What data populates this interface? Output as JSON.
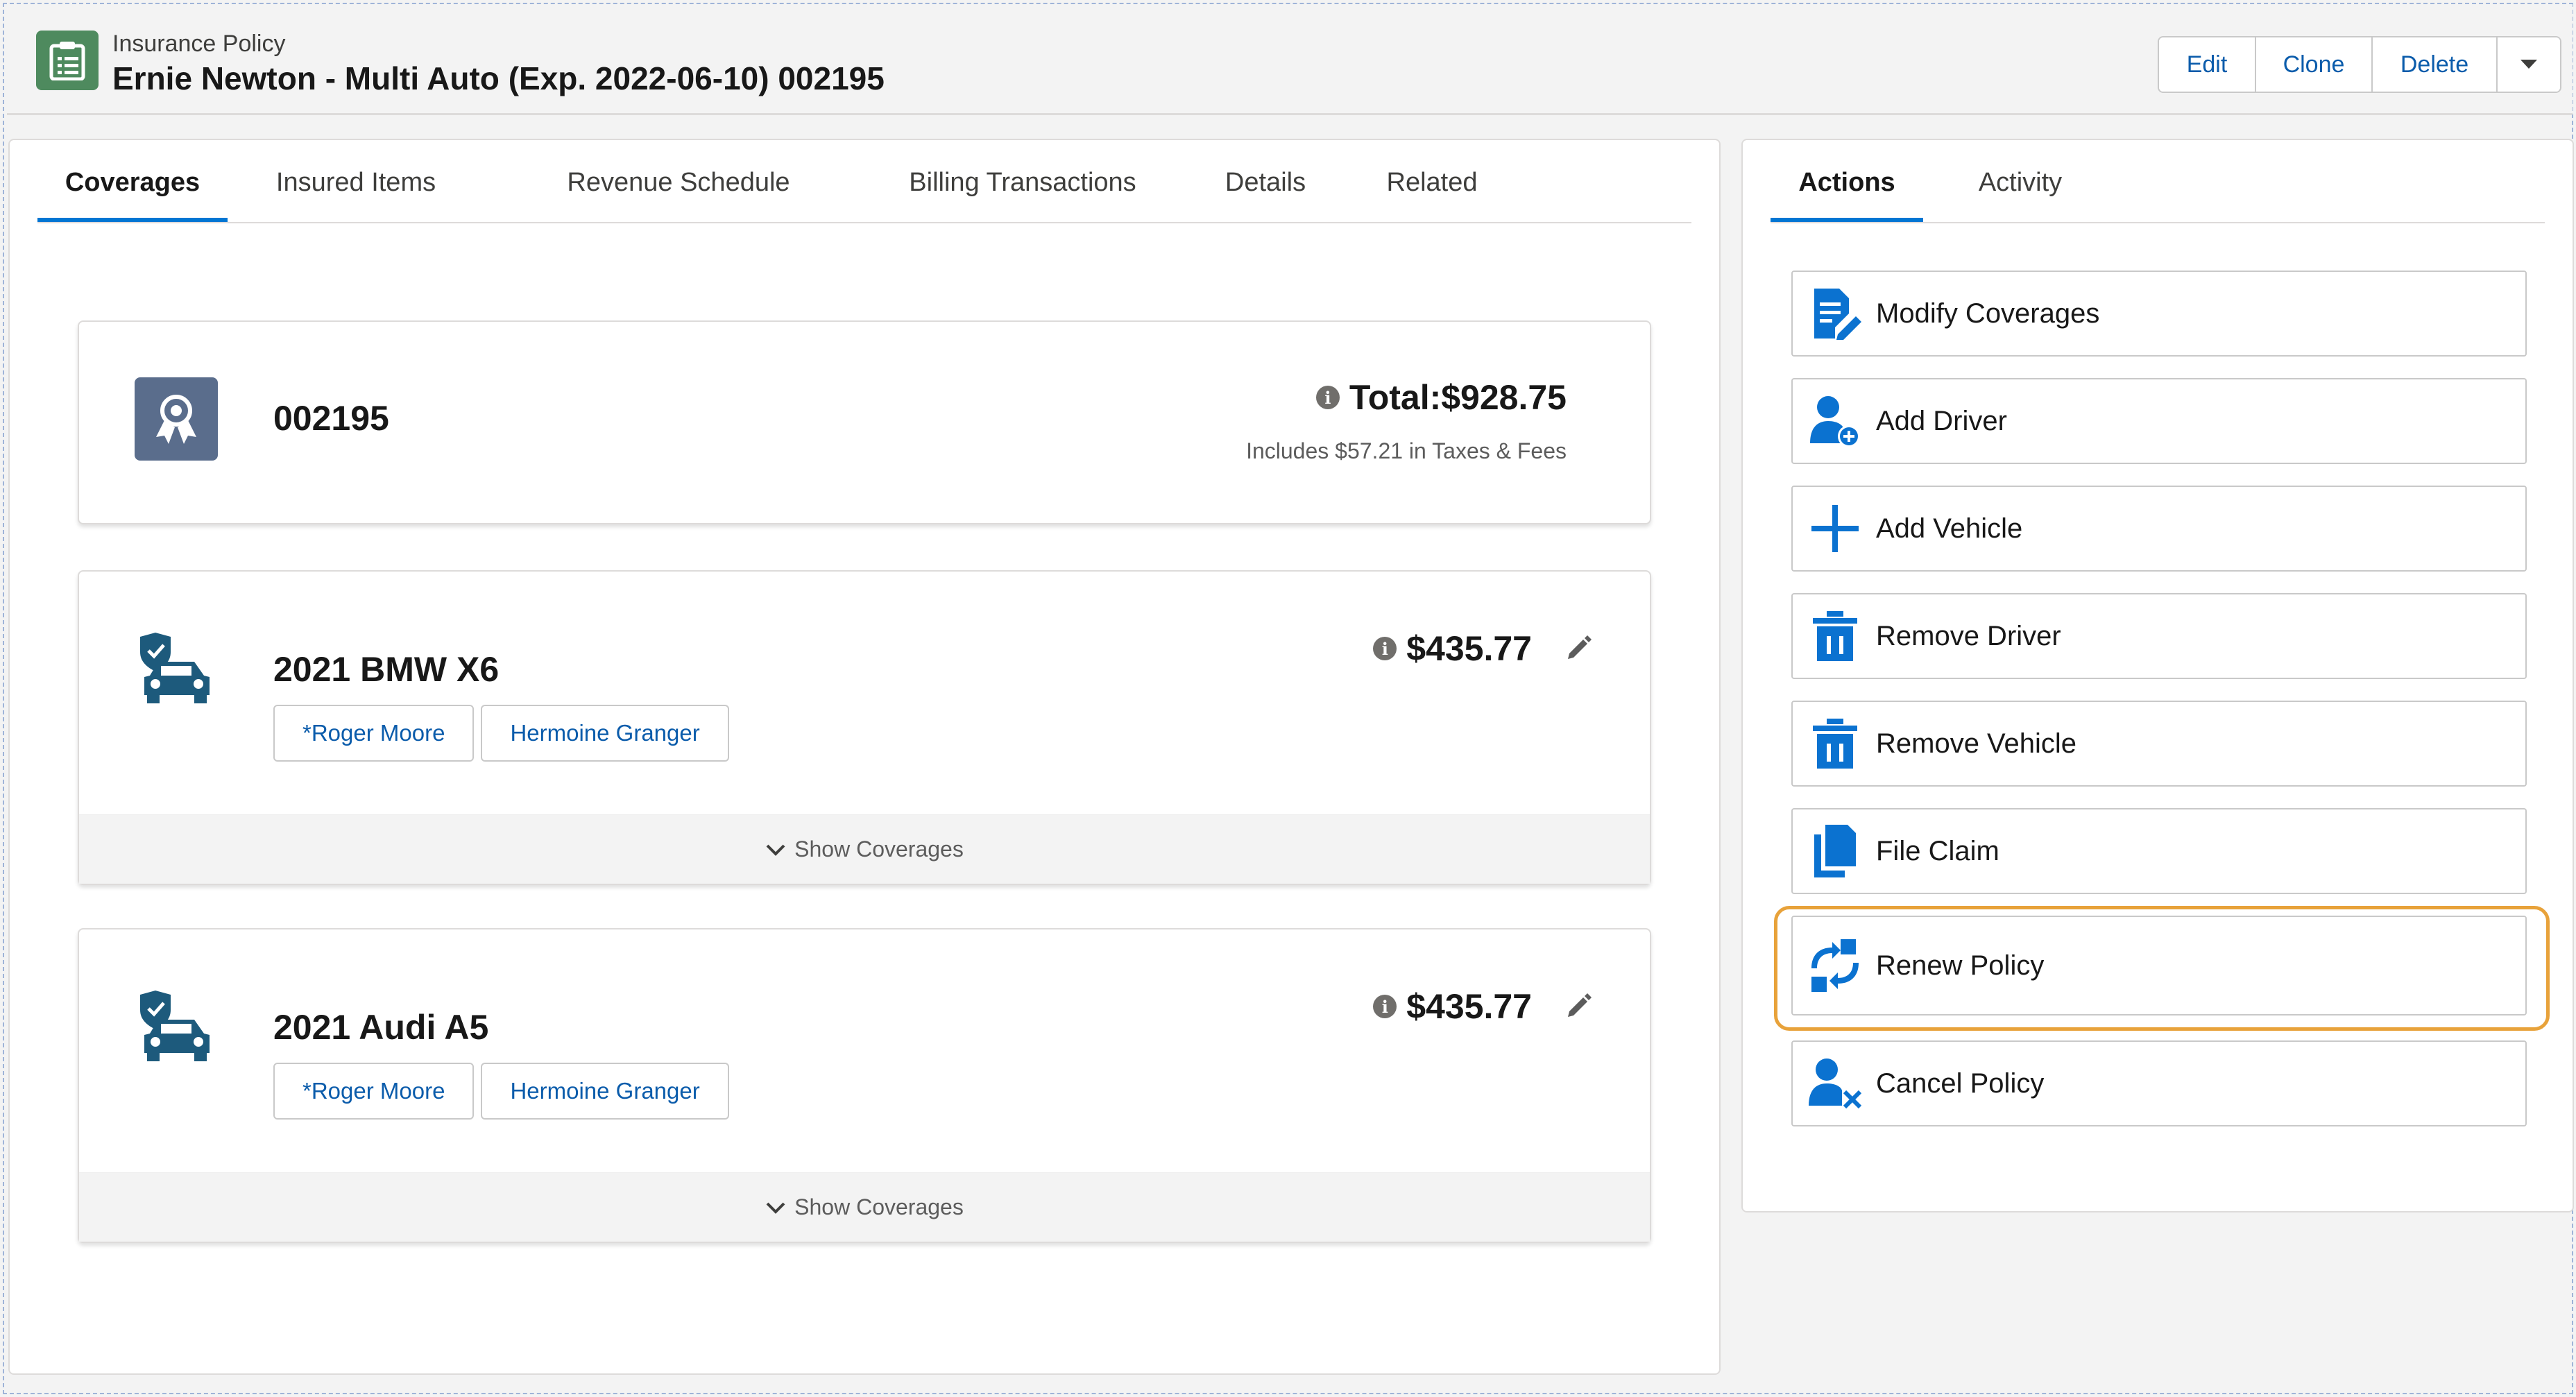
{
  "header": {
    "object_type": "Insurance Policy",
    "title": "Ernie Newton - Multi Auto (Exp. 2022-06-10) 002195",
    "buttons": {
      "edit": "Edit",
      "clone": "Clone",
      "delete": "Delete"
    }
  },
  "main_tabs": [
    "Coverages",
    "Insured Items",
    "Revenue Schedule",
    "Billing Transactions",
    "Details",
    "Related"
  ],
  "active_main_tab": "Coverages",
  "policy_summary": {
    "number": "002195",
    "total": "Total:$928.75",
    "taxes_note": "Includes $57.21 in Taxes & Fees"
  },
  "vehicles": [
    {
      "name": "2021 BMW X6",
      "price": "$435.77",
      "drivers": [
        "*Roger Moore",
        "Hermoine Granger"
      ],
      "show_coverages": "Show Coverages"
    },
    {
      "name": "2021 Audi A5",
      "price": "$435.77",
      "drivers": [
        "*Roger Moore",
        "Hermoine Granger"
      ],
      "show_coverages": "Show Coverages"
    }
  ],
  "side_tabs": [
    "Actions",
    "Activity"
  ],
  "active_side_tab": "Actions",
  "actions": [
    {
      "label": "Modify Coverages",
      "icon": "document-edit-icon"
    },
    {
      "label": "Add Driver",
      "icon": "user-add-icon"
    },
    {
      "label": "Add Vehicle",
      "icon": "plus-icon"
    },
    {
      "label": "Remove Driver",
      "icon": "trash-icon"
    },
    {
      "label": "Remove Vehicle",
      "icon": "trash-icon"
    },
    {
      "label": "File Claim",
      "icon": "file-copy-icon"
    },
    {
      "label": "Renew Policy",
      "icon": "renew-icon"
    },
    {
      "label": "Cancel Policy",
      "icon": "user-remove-icon"
    }
  ],
  "highlighted_action": "Renew Policy",
  "colors": {
    "accent": "#0176d3",
    "link": "#0b5cab",
    "icon_blue": "#0b72d0",
    "highlight": "#e8a23a",
    "header_icon": "#4e8a5e",
    "vehicle_icon": "#1d5a7c"
  }
}
